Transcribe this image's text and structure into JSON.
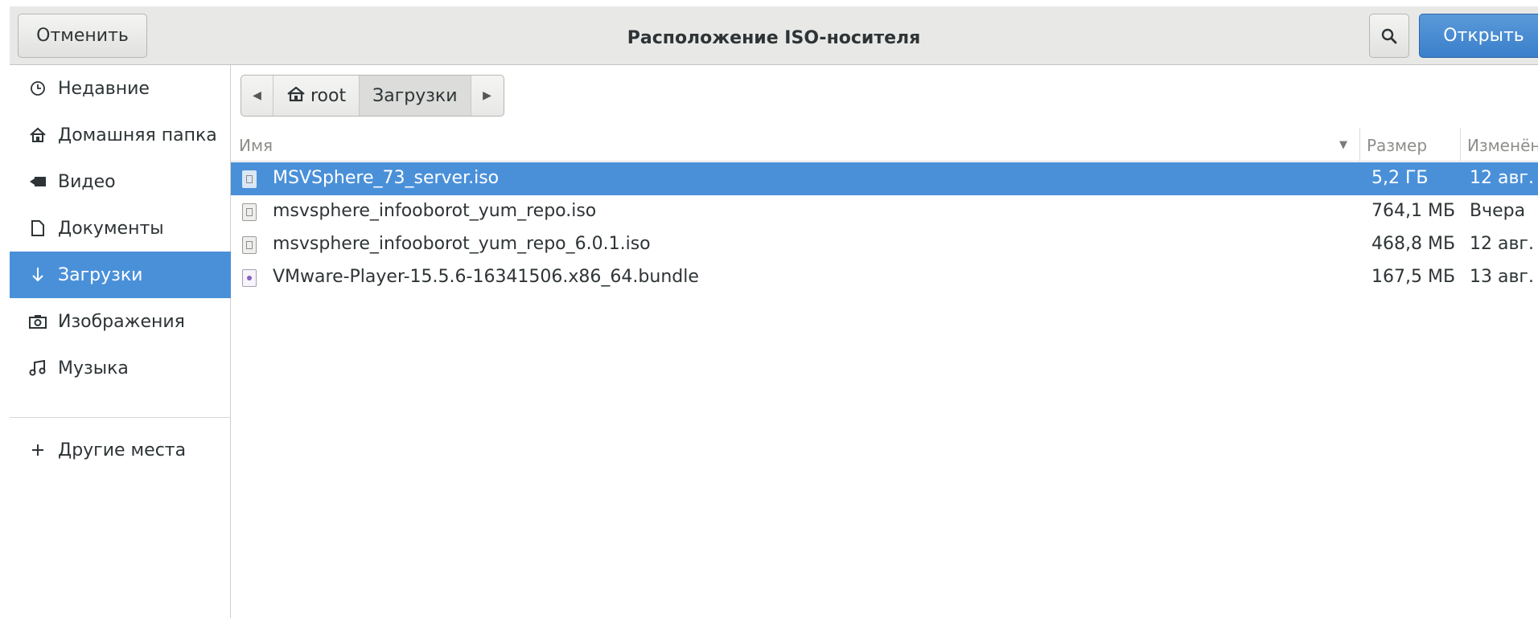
{
  "header": {
    "cancel_label": "Отменить",
    "title": "Расположение ISO-носителя",
    "open_label": "Открыть",
    "search_icon": "search-icon"
  },
  "sidebar": {
    "items": [
      {
        "label": "Недавние",
        "icon": "clock-icon"
      },
      {
        "label": "Домашняя папка",
        "icon": "home-icon"
      },
      {
        "label": "Видео",
        "icon": "video-icon"
      },
      {
        "label": "Документы",
        "icon": "document-icon"
      },
      {
        "label": "Загрузки",
        "icon": "download-icon",
        "active": true
      },
      {
        "label": "Изображения",
        "icon": "camera-icon"
      },
      {
        "label": "Музыка",
        "icon": "music-icon"
      },
      {
        "label": "Другие места",
        "icon": "plus-icon"
      }
    ]
  },
  "pathbar": {
    "segments": [
      "root",
      "Загрузки"
    ],
    "current": "Загрузки"
  },
  "columns": {
    "name": "Имя",
    "size": "Размер",
    "modified": "Изменён"
  },
  "files": [
    {
      "name": "MSVSphere_73_server.iso",
      "size": "5,2 ГБ",
      "modified": "12 авг.",
      "selected": true,
      "type": "iso"
    },
    {
      "name": "msvsphere_infooborot_yum_repo.iso",
      "size": "764,1 МБ",
      "modified": "Вчера",
      "type": "iso"
    },
    {
      "name": "msvsphere_infooborot_yum_repo_6.0.1.iso",
      "size": "468,8 МБ",
      "modified": "12 авг.",
      "type": "iso"
    },
    {
      "name": "VMware-Player-15.5.6-16341506.x86_64.bundle",
      "size": "167,5 МБ",
      "modified": "13 авг.",
      "type": "bundle"
    }
  ],
  "colors": {
    "accent": "#4a90d9",
    "header_bg": "#e8e8e7"
  }
}
